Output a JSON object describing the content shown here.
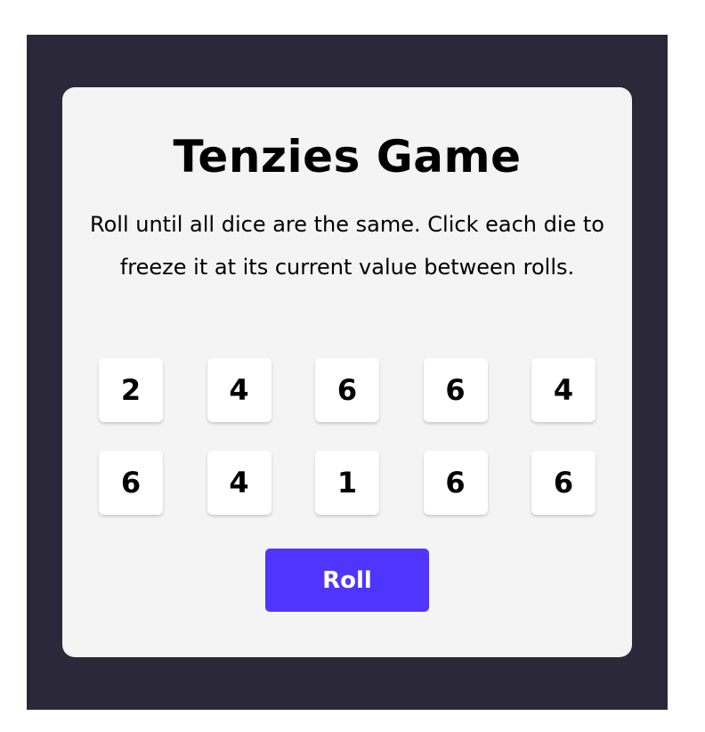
{
  "game": {
    "title": "Tenzies Game",
    "instructions": "Roll until all dice are the same. Click each die to freeze it at its current value between rolls.",
    "dice": [
      "2",
      "4",
      "6",
      "6",
      "4",
      "6",
      "4",
      "1",
      "6",
      "6"
    ],
    "roll_label": "Roll"
  },
  "colors": {
    "frame_background": "#2b283a",
    "card_background": "#f4f4f4",
    "die_background": "#ffffff",
    "button_background": "#5035ff",
    "button_text": "#ffffff"
  }
}
